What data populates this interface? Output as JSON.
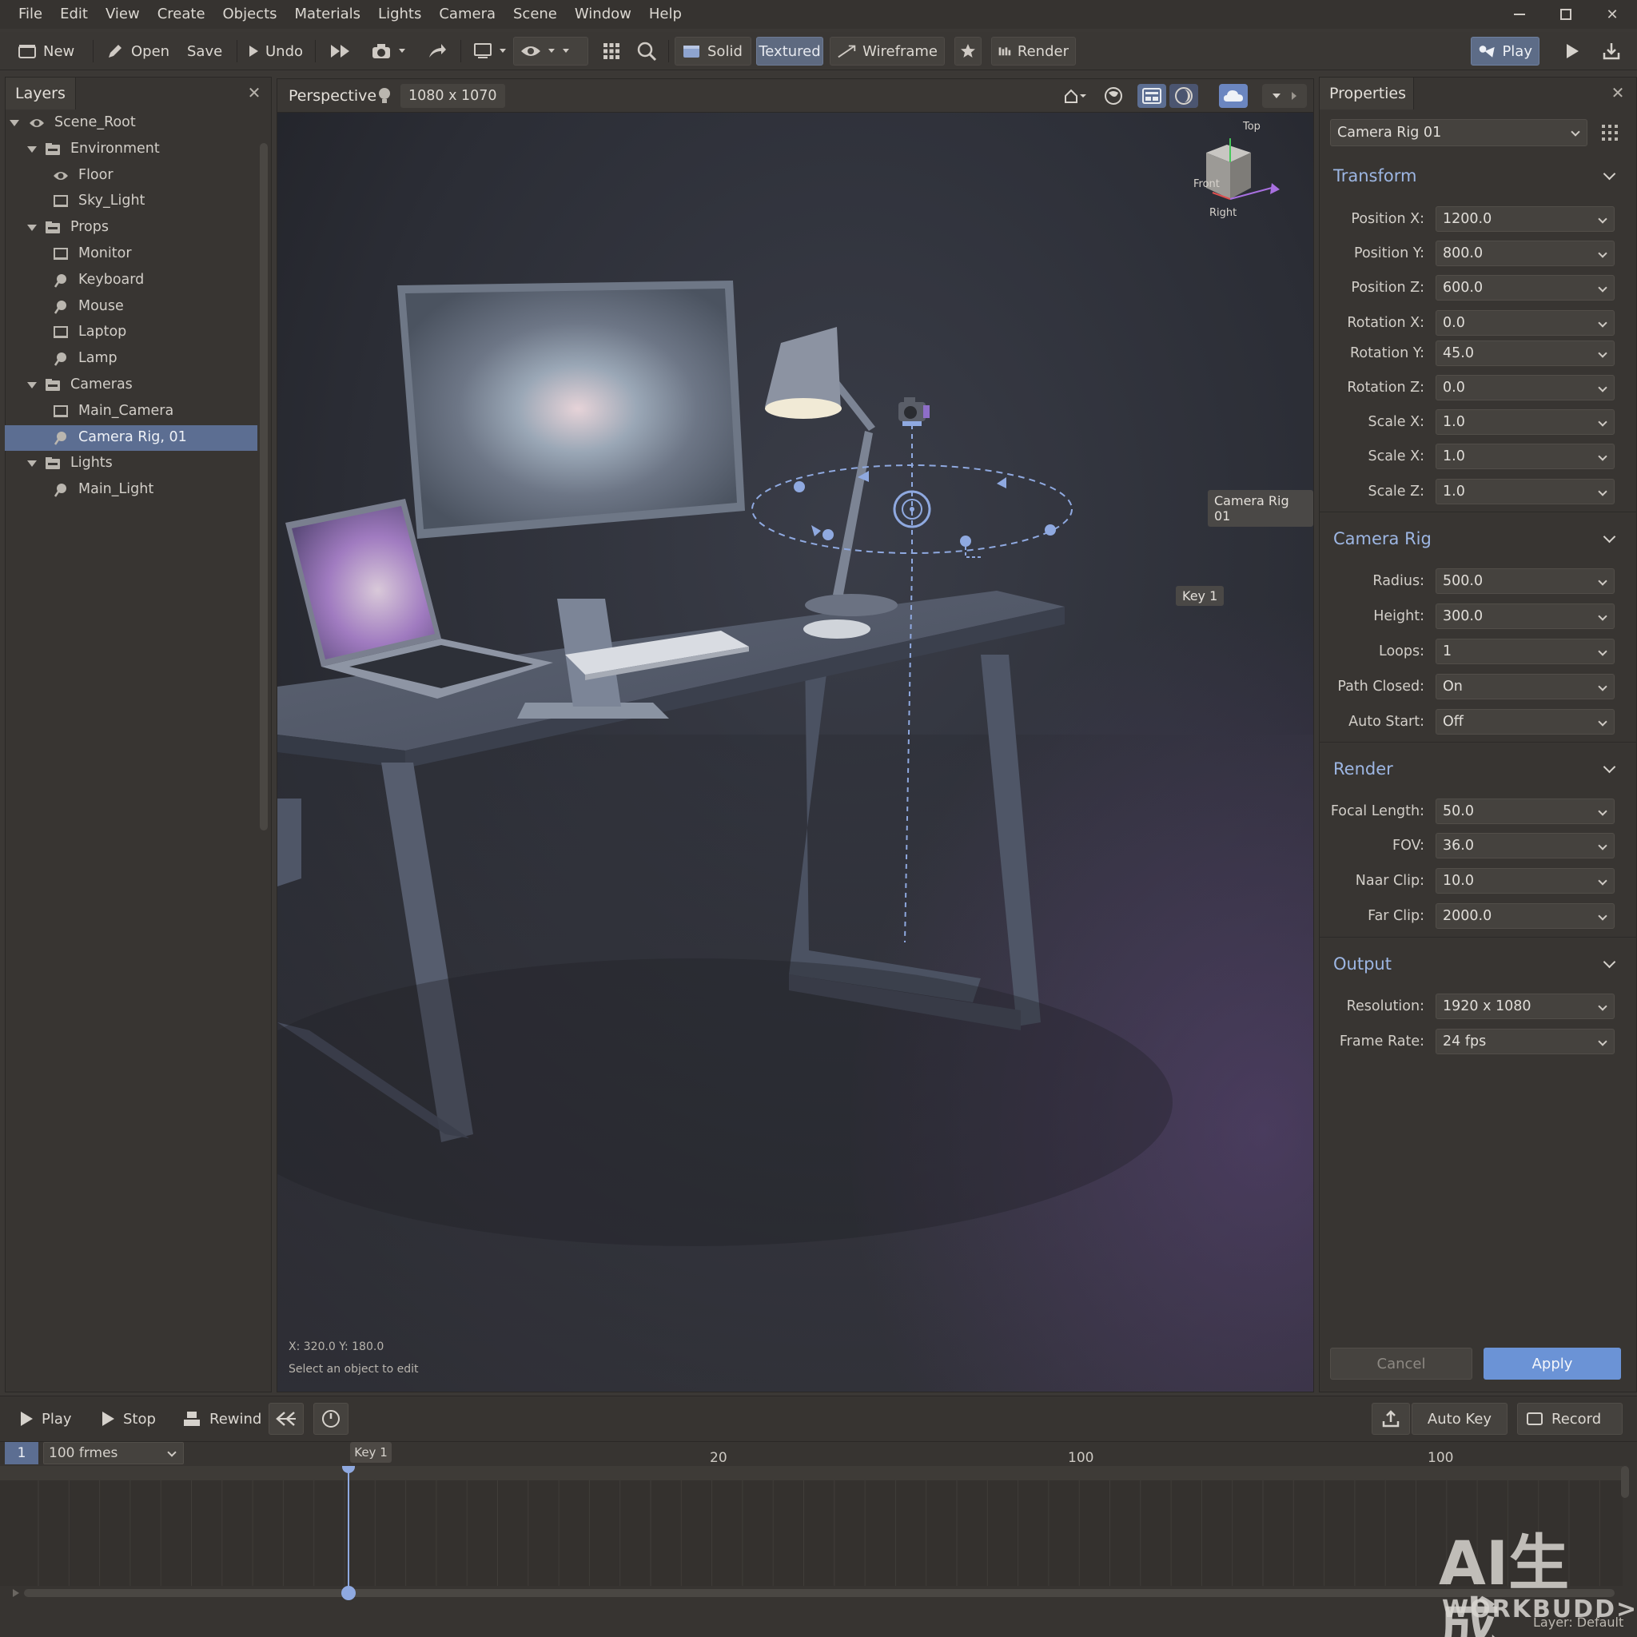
{
  "menu": [
    "File",
    "Edit",
    "View",
    "Create",
    "Objects",
    "Materials",
    "Lights",
    "Camera",
    "Scene",
    "Window",
    "Help"
  ],
  "toolbar": {
    "new_label": "New",
    "open_label": "Open",
    "save_label": "Save",
    "undo_label": "Undo",
    "solid_label": "Solid",
    "textured_label": "Textured",
    "wireframe_label": "Wireframe",
    "render_label": "Render",
    "play_label": "Play"
  },
  "layers": {
    "tab_label": "Layers",
    "items": [
      {
        "label": "Scene_Root",
        "depth": 0
      },
      {
        "label": "Environment",
        "depth": 1
      },
      {
        "label": "Floor",
        "depth": 2
      },
      {
        "label": "Sky_Light",
        "depth": 2
      },
      {
        "label": "Props",
        "depth": 1
      },
      {
        "label": "Monitor",
        "depth": 2
      },
      {
        "label": "Keyboard",
        "depth": 2
      },
      {
        "label": "Mouse",
        "depth": 2
      },
      {
        "label": "Laptop",
        "depth": 2
      },
      {
        "label": "Lamp",
        "depth": 2
      },
      {
        "label": "Cameras",
        "depth": 1
      },
      {
        "label": "Main_Camera",
        "depth": 2
      },
      {
        "label": "Camera Rig, 01",
        "depth": 2,
        "selected": true
      },
      {
        "label": "Lights",
        "depth": 1
      },
      {
        "label": "Main_Light",
        "depth": 2
      }
    ]
  },
  "viewport": {
    "title": "Perspective",
    "resolution": "1080 x 1070",
    "gizmo": {
      "top": "Top",
      "front": "Front",
      "right": "Right"
    },
    "camera_label": "Camera Rig 01",
    "key_label": "Key 1",
    "coords": "X: 320.0  Y: 180.0",
    "hint": "Select an object to edit"
  },
  "properties": {
    "tab_label": "Properties",
    "object_selector": "Camera Rig 01",
    "sections": [
      {
        "title": "Transform",
        "rows": [
          {
            "label": "Position X:",
            "value": "1200.0"
          },
          {
            "label": "Position Y:",
            "value": "800.0"
          },
          {
            "label": "Position Z:",
            "value": "600.0"
          },
          {
            "label": "Rotation X:",
            "value": "0.0"
          },
          {
            "label": "Rotation Y:",
            "value": "45.0"
          },
          {
            "label": "Rotation Z:",
            "value": "0.0"
          },
          {
            "label": "Scale X:",
            "value": "1.0"
          },
          {
            "label": "Scale X:",
            "value": "1.0"
          },
          {
            "label": "Scale Z:",
            "value": "1.0"
          }
        ]
      },
      {
        "title": "Camera Rig",
        "rows": [
          {
            "label": "Radius:",
            "value": "500.0"
          },
          {
            "label": "Height:",
            "value": "300.0"
          },
          {
            "label": "Loops:",
            "value": "1"
          },
          {
            "label": "Path Closed:",
            "value": "On"
          },
          {
            "label": "Auto Start:",
            "value": "Off"
          }
        ]
      },
      {
        "title": "Render",
        "rows": [
          {
            "label": "Focal Length:",
            "value": "50.0"
          },
          {
            "label": "FOV:",
            "value": "36.0"
          },
          {
            "label": "Naar Clip:",
            "value": "10.0"
          },
          {
            "label": "Far Clip:",
            "value": "2000.0"
          }
        ]
      },
      {
        "title": "Output",
        "rows": [
          {
            "label": "Resolution:",
            "value": "1920 x 1080"
          },
          {
            "label": "Frame Rate:",
            "value": "24 fps"
          }
        ]
      }
    ],
    "cancel_label": "Cancel",
    "apply_label": "Apply"
  },
  "timeline": {
    "play_label": "Play",
    "stop_label": "Stop",
    "rewind_label": "Rewind",
    "auto_key_label": "Auto Key",
    "record_label": "Record",
    "current_frame": "1",
    "frames_select": "100 frmes",
    "key_label": "Key 1",
    "ruler": [
      "20",
      "100",
      "100"
    ]
  },
  "watermark": {
    "line1": "AI生成",
    "line2": "WORKBUDD>"
  },
  "status": "Layer: Default",
  "colors": {
    "accent": "#5c6e92",
    "apply": "#6b93d6",
    "section": "#9db6e3",
    "rig": "#8fa9e0"
  }
}
